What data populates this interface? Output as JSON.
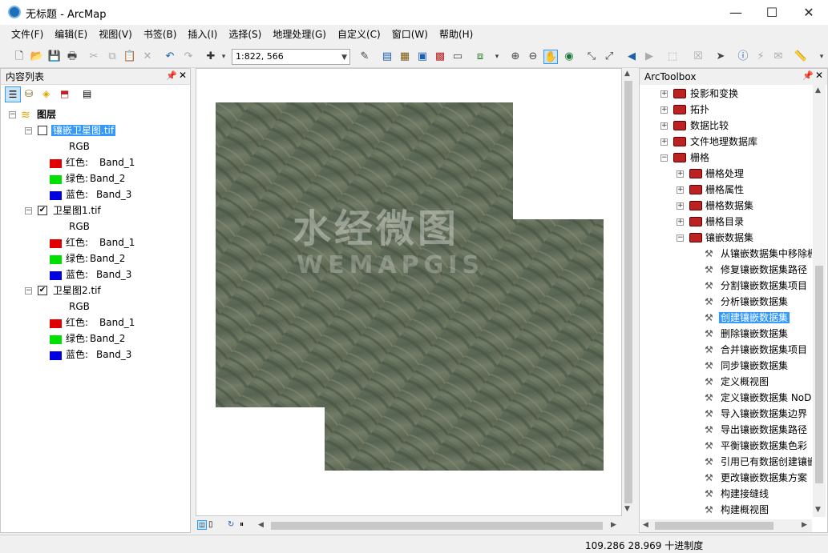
{
  "window": {
    "title": "无标题 - ArcMap",
    "minimize": "—",
    "maximize": "☐",
    "close": "✕"
  },
  "menu": [
    "文件(F)",
    "编辑(E)",
    "视图(V)",
    "书签(B)",
    "插入(I)",
    "选择(S)",
    "地理处理(G)",
    "自定义(C)",
    "窗口(W)",
    "帮助(H)"
  ],
  "toolbar": {
    "scale": "1:822, 566"
  },
  "toc": {
    "title": "内容列表",
    "root": "图层",
    "layers": [
      {
        "name": "镶嵌卫星图.tif",
        "checked": false,
        "selected": true,
        "rgb": "RGB",
        "bands": [
          {
            "label": "红色:",
            "band": "Band_1",
            "color": "#e00000"
          },
          {
            "label": "绿色:",
            "band": "Band_2",
            "color": "#00e000"
          },
          {
            "label": "蓝色:",
            "band": "Band_3",
            "color": "#0000e0"
          }
        ]
      },
      {
        "name": "卫星图1.tif",
        "checked": true,
        "selected": false,
        "rgb": "RGB",
        "bands": [
          {
            "label": "红色:",
            "band": "Band_1",
            "color": "#e00000"
          },
          {
            "label": "绿色:",
            "band": "Band_2",
            "color": "#00e000"
          },
          {
            "label": "蓝色:",
            "band": "Band_3",
            "color": "#0000e0"
          }
        ]
      },
      {
        "name": "卫星图2.tif",
        "checked": true,
        "selected": false,
        "rgb": "RGB",
        "bands": [
          {
            "label": "红色:",
            "band": "Band_1",
            "color": "#e00000"
          },
          {
            "label": "绿色:",
            "band": "Band_2",
            "color": "#00e000"
          },
          {
            "label": "蓝色:",
            "band": "Band_3",
            "color": "#0000e0"
          }
        ]
      }
    ]
  },
  "map": {
    "watermark_cn": "水经微图",
    "watermark_en": "WEMAPGIS"
  },
  "toolbox": {
    "title": "ArcToolbox",
    "toolsets_top": [
      "投影和变换",
      "拓扑",
      "数据比较",
      "文件地理数据库",
      "栅格"
    ],
    "raster_children": [
      "栅格处理",
      "栅格属性",
      "栅格数据集",
      "栅格目录",
      "镶嵌数据集"
    ],
    "mosaic_tools": [
      "从镶嵌数据集中移除栅",
      "修复镶嵌数据集路径",
      "分割镶嵌数据集项目",
      "分析镶嵌数据集",
      "创建镶嵌数据集",
      "删除镶嵌数据集",
      "合并镶嵌数据集项目",
      "同步镶嵌数据集",
      "定义概视图",
      "定义镶嵌数据集 NoD",
      "导入镶嵌数据集边界",
      "导出镶嵌数据集路径",
      "平衡镶嵌数据集色彩",
      "引用已有数据创建镶嵌",
      "更改镶嵌数据集方案",
      "构建接缝线",
      "构建概视图"
    ],
    "selected_tool": "创建镶嵌数据集"
  },
  "status": {
    "coords": "109.286  28.969 十进制度"
  }
}
